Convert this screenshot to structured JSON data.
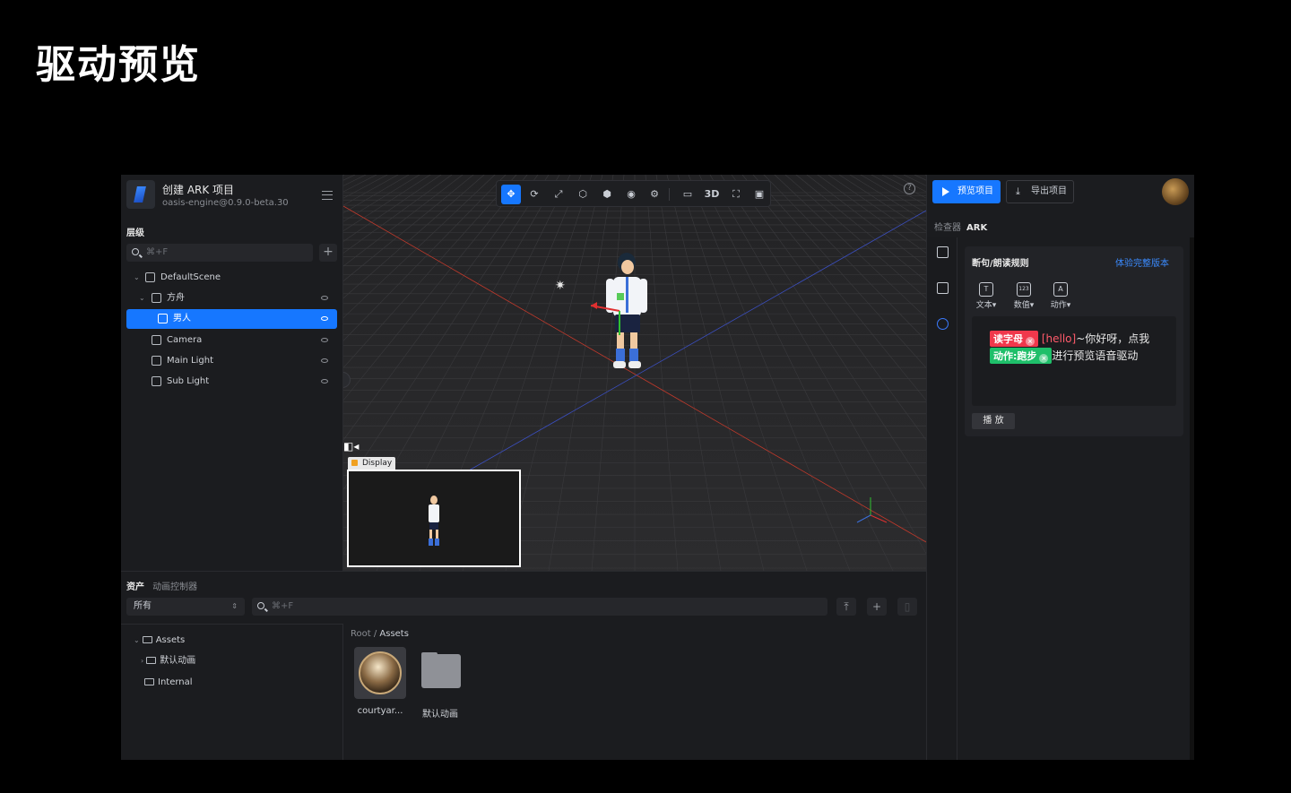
{
  "slide_title": "驱动预览",
  "project": {
    "name": "创建 ARK 项目",
    "version": "oasis-engine@0.9.0-beta.30"
  },
  "hierarchy": {
    "label": "层级",
    "search_placeholder": "⌘+F",
    "items": [
      {
        "label": "DefaultScene"
      },
      {
        "label": "方舟"
      },
      {
        "label": "男人"
      },
      {
        "label": "Camera"
      },
      {
        "label": "Main Light"
      },
      {
        "label": "Sub Light"
      }
    ]
  },
  "viewport": {
    "toolbar": [
      "move-icon",
      "rotate-icon",
      "scale-icon",
      "rect-icon",
      "box-icon",
      "circle-icon",
      "gear-icon",
      "camera-icon",
      "3D",
      "fullscreen-icon",
      "image-icon"
    ],
    "mode_label": "3D",
    "display_label": "Display"
  },
  "assets": {
    "tab_assets": "资产",
    "tab_anim": "动画控制器",
    "filter_value": "所有",
    "search_placeholder": "⌘+F",
    "tree": [
      {
        "label": "Assets"
      },
      {
        "label": "默认动画"
      },
      {
        "label": "Internal"
      }
    ],
    "breadcrumb_root": "Root",
    "breadcrumb_sep": " / ",
    "breadcrumb_current": "Assets",
    "files": [
      {
        "label": "courtyar..."
      },
      {
        "label": "默认动画"
      }
    ]
  },
  "inspector": {
    "preview_btn": "预览项目",
    "export_btn": "导出项目",
    "header_key": "检查器",
    "header_val": "ARK",
    "card_title": "断句/朗读规则",
    "card_link": "体验完整版本",
    "tools": [
      {
        "icon": "T",
        "label": "文本▾"
      },
      {
        "icon": "123",
        "label": "数值▾"
      },
      {
        "icon": "A",
        "label": "动作▾"
      }
    ],
    "chip_red": "读字母",
    "text_hello": "[hello]",
    "text_1": "~你好呀，点我",
    "chip_green": "动作:跑步",
    "text_2": "进行预览语音驱动",
    "play_btn": "播 放"
  },
  "colors": {
    "accent": "#1677ff",
    "chip_red": "#f0384c",
    "chip_green": "#1fbf6a"
  }
}
